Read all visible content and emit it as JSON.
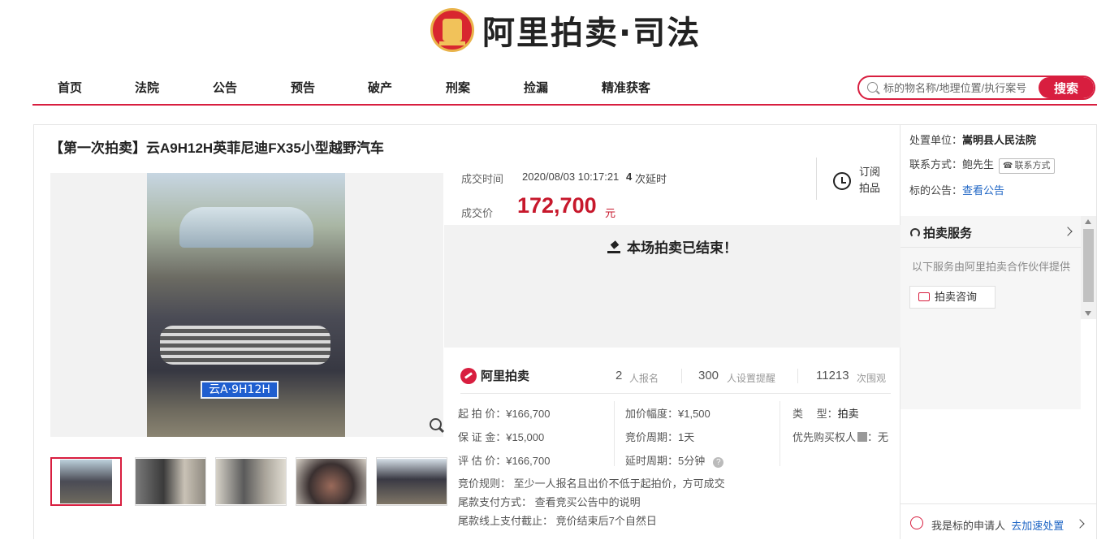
{
  "brand": {
    "title": "阿里拍卖·司法"
  },
  "nav": [
    "首页",
    "法院",
    "公告",
    "预告",
    "破产",
    "刑案",
    "捡漏",
    "精准获客"
  ],
  "search": {
    "placeholder": "标的物名称/地理位置/执行案号",
    "button": "搜索"
  },
  "item": {
    "title": "【第一次拍卖】云A9H12H英菲尼迪FX35小型越野汽车",
    "plate_text": "云A·9H12H",
    "deal_time_label": "成交时间",
    "deal_time": "2020/08/03 10:17:21",
    "delay_count": "4",
    "delay_text": "次延时",
    "subscribe": "订阅拍品",
    "price_label": "成交价",
    "price": "172,700",
    "price_unit": "元",
    "ended_text": "本场拍卖已结束！"
  },
  "stats": {
    "brand": "阿里拍卖",
    "signups": "2",
    "signups_label": "人报名",
    "reminders": "300",
    "reminders_label": "人设置提醒",
    "views": "11213",
    "views_label": "次围观"
  },
  "info": {
    "start_price": "起 拍 价：¥166,700",
    "deposit": "保 证 金：¥15,000",
    "appraisal": "评 估 价：¥166,700",
    "increment": "加价幅度：¥1,500",
    "period": "竞价周期：1天",
    "delay_period": "延时周期：5分钟",
    "type_label": "类　 型：",
    "type_value": "拍卖",
    "priority_label": "优先购买权人",
    "priority_value": "：无",
    "rule": "竞价规则：  至少一人报名且出价不低于起拍价，方可成交",
    "payment": "尾款支付方式：   查看竞买公告中的说明",
    "deadline": "尾款线上支付截止：   竞价结束后7个自然日"
  },
  "sidebar": {
    "court_label": "处置单位：",
    "court": "嵩明县人民法院",
    "contact_label": "联系方式：",
    "contact": "鲍先生",
    "contact_button": "联系方式",
    "notice_label": "标的公告：",
    "notice_link": "查看公告",
    "service_title": "拍卖服务",
    "service_desc": "以下服务由阿里拍卖合作伙伴提供",
    "consult_button": "拍卖咨询",
    "applicant_text": "我是标的申请人",
    "applicant_link": "去加速处置"
  },
  "colors": {
    "accent": "#d81e3f",
    "price": "#c7182c",
    "link": "#1f66c5"
  }
}
